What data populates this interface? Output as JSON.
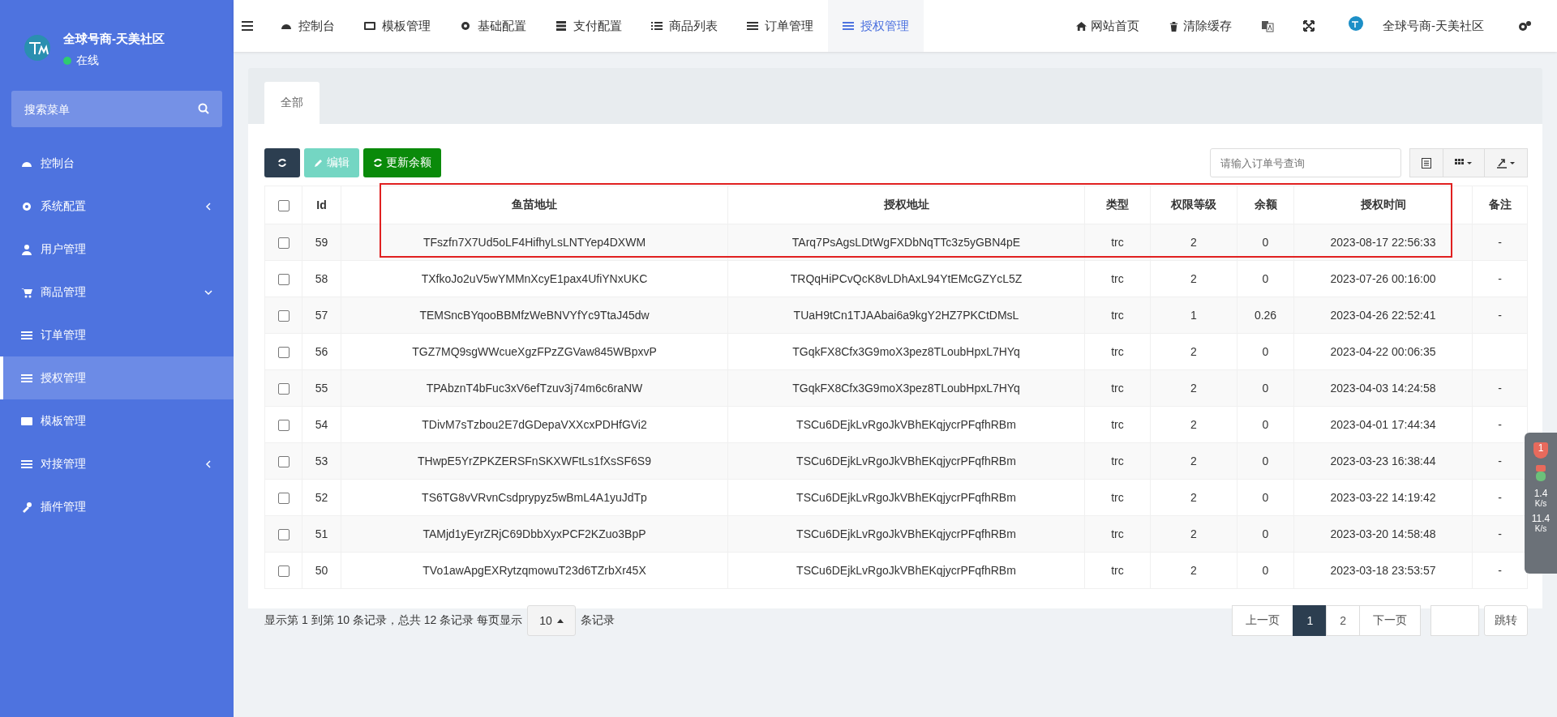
{
  "sidebar": {
    "brand": "全球号商-天美社区",
    "status": "在线",
    "search": {
      "placeholder": "搜索菜单"
    },
    "items": [
      {
        "label": "控制台",
        "kind": "dashboard",
        "selected": false
      },
      {
        "label": "系统配置",
        "kind": "gear",
        "selected": false,
        "expanded": false
      },
      {
        "label": "用户管理",
        "kind": "user",
        "selected": false
      },
      {
        "label": "商品管理",
        "kind": "cart",
        "selected": false,
        "expanded": true
      },
      {
        "label": "订单管理",
        "kind": "bars",
        "selected": false
      },
      {
        "label": "授权管理",
        "kind": "bars",
        "selected": true
      },
      {
        "label": "模板管理",
        "kind": "card",
        "selected": false
      },
      {
        "label": "对接管理",
        "kind": "sliders",
        "selected": false,
        "expanded": false
      },
      {
        "label": "插件管理",
        "kind": "wrench",
        "selected": false
      }
    ]
  },
  "topnav": {
    "items": [
      {
        "label": "控制台",
        "kind": "dashboard",
        "selected": false
      },
      {
        "label": "模板管理",
        "kind": "card",
        "selected": false
      },
      {
        "label": "基础配置",
        "kind": "gear",
        "selected": false
      },
      {
        "label": "支付配置",
        "kind": "server",
        "selected": false
      },
      {
        "label": "商品列表",
        "kind": "list",
        "selected": false
      },
      {
        "label": "订单管理",
        "kind": "bars",
        "selected": false
      },
      {
        "label": "授权管理",
        "kind": "bars",
        "selected": true
      }
    ],
    "links": [
      {
        "label": "网站首页",
        "kind": "home"
      },
      {
        "label": "清除缓存",
        "kind": "trash"
      }
    ],
    "user": "全球号商-天美社区"
  },
  "tabs": [
    {
      "label": "全部",
      "selected": true
    }
  ],
  "toolbar": {
    "buttons": [
      {
        "kind": "refresh"
      },
      {
        "kind": "edit",
        "label": "编辑",
        "disabled": true
      },
      {
        "kind": "update",
        "label": "更新余额"
      }
    ],
    "search": {
      "placeholder": "请输入订单号查询"
    }
  },
  "table": {
    "all_checked": false,
    "columns": [
      "Id",
      "鱼苗地址",
      "授权地址",
      "类型",
      "权限等级",
      "余额",
      "授权时间",
      "备注"
    ],
    "rows": [
      {
        "checked": false,
        "cells": [
          "59",
          "TFszfn7X7Ud5oLF4HifhyLsLNTYep4DXWM",
          "TArq7PsAgsLDtWgFXDbNqTTc3z5yGBN4pE",
          "trc",
          "2",
          "0",
          "2023-08-17 22:56:33",
          "-"
        ]
      },
      {
        "checked": false,
        "cells": [
          "58",
          "TXfkoJo2uV5wYMMnXcyE1pax4UfiYNxUKC",
          "TRQqHiPCvQcK8vLDhAxL94YtEMcGZYcL5Z",
          "trc",
          "2",
          "0",
          "2023-07-26 00:16:00",
          "-"
        ]
      },
      {
        "checked": false,
        "cells": [
          "57",
          "TEMSncBYqooBBMfzWeBNVYfYc9TtaJ45dw",
          "TUaH9tCn1TJAAbai6a9kgY2HZ7PKCtDMsL",
          "trc",
          "1",
          "0.26",
          "2023-04-26 22:52:41",
          "-"
        ]
      },
      {
        "checked": false,
        "cells": [
          "56",
          "TGZ7MQ9sgWWcueXgzFPzZGVaw845WBpxvP",
          "TGqkFX8Cfx3G9moX3pez8TLoubHpxL7HYq",
          "trc",
          "2",
          "0",
          "2023-04-22 00:06:35",
          ""
        ]
      },
      {
        "checked": false,
        "cells": [
          "55",
          "TPAbznT4bFuc3xV6efTzuv3j74m6c6raNW",
          "TGqkFX8Cfx3G9moX3pez8TLoubHpxL7HYq",
          "trc",
          "2",
          "0",
          "2023-04-03 14:24:58",
          "-"
        ]
      },
      {
        "checked": false,
        "cells": [
          "54",
          "TDivM7sTzbou2E7dGDepaVXXcxPDHfGVi2",
          "TSCu6DEjkLvRgoJkVBhEKqjycrPFqfhRBm",
          "trc",
          "2",
          "0",
          "2023-04-01 17:44:34",
          "-"
        ]
      },
      {
        "checked": false,
        "cells": [
          "53",
          "THwpE5YrZPKZERSFnSKXWFtLs1fXsSF6S9",
          "TSCu6DEjkLvRgoJkVBhEKqjycrPFqfhRBm",
          "trc",
          "2",
          "0",
          "2023-03-23 16:38:44",
          "-"
        ]
      },
      {
        "checked": false,
        "cells": [
          "52",
          "TS6TG8vVRvnCsdprypyz5wBmL4A1yuJdTp",
          "TSCu6DEjkLvRgoJkVBhEKqjycrPFqfhRBm",
          "trc",
          "2",
          "0",
          "2023-03-22 14:19:42",
          "-"
        ]
      },
      {
        "checked": false,
        "cells": [
          "51",
          "TAMjd1yEyrZRjC69DbbXyxPCF2KZuo3BpP",
          "TSCu6DEjkLvRgoJkVBhEKqjycrPFqfhRBm",
          "trc",
          "2",
          "0",
          "2023-03-20 14:58:48",
          "-"
        ]
      },
      {
        "checked": false,
        "cells": [
          "50",
          "TVo1awApgEXRytzqmowuT23d6TZrbXr45X",
          "TSCu6DEjkLvRgoJkVBhEKqjycrPFqfhRBm",
          "trc",
          "2",
          "0",
          "2023-03-18 23:53:57",
          "-"
        ]
      }
    ]
  },
  "pagination": {
    "summary": "显示第 1 到第 10 条记录，总共 12 条记录 每页显示",
    "page_size": "10",
    "suffix": "条记录",
    "pages": [
      {
        "label": "上一页",
        "selected": false
      },
      {
        "label": "1",
        "selected": true
      },
      {
        "label": "2",
        "selected": false
      },
      {
        "label": "下一页",
        "selected": false
      }
    ],
    "jump": "跳转"
  },
  "speed_widget": {
    "badge": "1",
    "up": "1.4",
    "up_unit": "K/s",
    "down": "11.4",
    "down_unit": "K/s"
  }
}
